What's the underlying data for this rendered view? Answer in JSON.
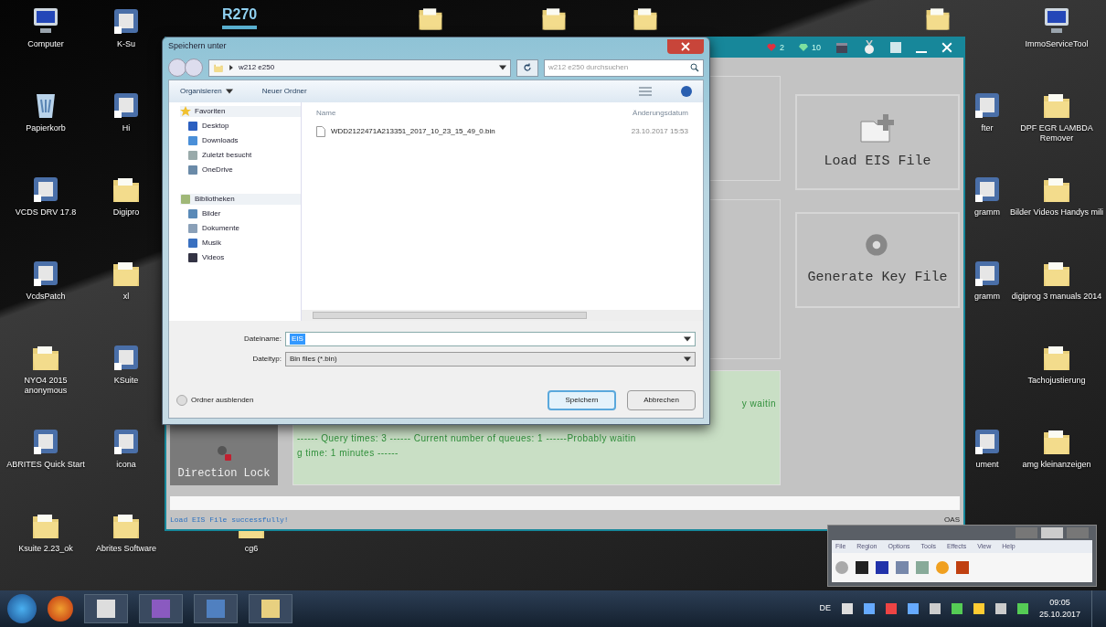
{
  "desktop": {
    "columns": [
      {
        "icons": [
          {
            "kind": "computer",
            "label": "Computer"
          },
          {
            "kind": "trash",
            "label": "Papierkorb"
          },
          {
            "kind": "app",
            "label": "VCDS DRV 17.8"
          },
          {
            "kind": "app",
            "label": "VcdsPatch"
          },
          {
            "kind": "folder",
            "label": "NYO4 2015 anonymous"
          },
          {
            "kind": "app",
            "label": "ABRITES Quick Start"
          },
          {
            "kind": "folder",
            "label": "Ksuite 2.23_ok"
          }
        ]
      },
      {
        "icons": [
          {
            "kind": "app",
            "label": "K-Su"
          },
          {
            "kind": "app",
            "label": "Hi"
          },
          {
            "kind": "folder",
            "label": "Digipro"
          },
          {
            "kind": "folder",
            "label": "xl"
          },
          {
            "kind": "app",
            "label": "KSuite"
          },
          {
            "kind": "app",
            "label": "icona"
          },
          {
            "kind": "folder",
            "label": "Abrites Software"
          }
        ]
      },
      {
        "icons": [
          {
            "kind": "folder",
            "label": "cg6"
          }
        ]
      },
      {
        "icons": [
          {
            "kind": "app",
            "label": "fter"
          },
          {
            "kind": "app",
            "label": "gramm"
          },
          {
            "kind": "app",
            "label": "gramm"
          },
          {
            "kind": "app",
            "label": "ument"
          }
        ]
      },
      {
        "icons": [
          {
            "kind": "computer",
            "label": "ImmoServiceTool"
          },
          {
            "kind": "folder",
            "label": "DPF EGR LAMBDA Remover"
          },
          {
            "kind": "folder",
            "label": "Bilder Videos Handys mili"
          },
          {
            "kind": "folder",
            "label": "digiprog 3 manuals 2014"
          },
          {
            "kind": "folder",
            "label": "Tachojustierung"
          },
          {
            "kind": "folder",
            "label": "amg kleinanzeigen"
          }
        ]
      }
    ],
    "top_label": "R270"
  },
  "app_window": {
    "counters": [
      {
        "kind": "heart",
        "value": "2"
      },
      {
        "kind": "gem",
        "value": "10"
      }
    ],
    "side_button": "Direction Lock",
    "actions": [
      {
        "kind": "load",
        "label": "Load EIS File"
      },
      {
        "kind": "key",
        "label": "Generate Key File"
      }
    ],
    "log_lines": [
      "y waitin",
      "------ Query times: 3 ------ Current number of queues: 1 ------Probably waitin",
      "g time: 1 minutes ------"
    ],
    "status": "Load EIS File successfully!",
    "status_right": "OAS"
  },
  "dialog": {
    "title": "Speichern unter",
    "path": "w212 e250",
    "search_placeholder": "w212 e250 durchsuchen",
    "toolbar": [
      "Organisieren",
      "Neuer Ordner"
    ],
    "nav": [
      {
        "kind": "star",
        "label": "Favoriten",
        "children": [
          {
            "kind": "desktop",
            "label": "Desktop"
          },
          {
            "kind": "download",
            "label": "Downloads"
          },
          {
            "kind": "recent",
            "label": "Zuletzt besucht"
          },
          {
            "kind": "cloud",
            "label": "OneDrive"
          }
        ]
      },
      {
        "kind": "library",
        "label": "Bibliotheken",
        "children": [
          {
            "kind": "image",
            "label": "Bilder"
          },
          {
            "kind": "doc",
            "label": "Dokumente"
          },
          {
            "kind": "music",
            "label": "Musik"
          },
          {
            "kind": "video",
            "label": "Videos"
          }
        ]
      }
    ],
    "columns": [
      "Name",
      "Änderungsdatum"
    ],
    "files": [
      {
        "name": "WDD2122471A213351_2017_10_23_15_49_0.bin",
        "date": "23.10.2017 15:53"
      }
    ],
    "filename_label": "Dateiname:",
    "filename": {
      "value": "EIS",
      "selected": true
    },
    "filetype_label": "Dateityp:",
    "filetype": "Bin files (*.bin)",
    "hide_folders": "Ordner ausblenden",
    "buttons": [
      {
        "label": "Speichern",
        "default": true
      },
      {
        "label": "Abbrechen",
        "default": false
      }
    ]
  },
  "small_window": {
    "menu": [
      "File",
      "Region",
      "Options",
      "Tools",
      "Effects",
      "View",
      "Help"
    ]
  },
  "taskbar": {
    "language": "DE",
    "time": "09:05",
    "date": "25.10.2017"
  }
}
